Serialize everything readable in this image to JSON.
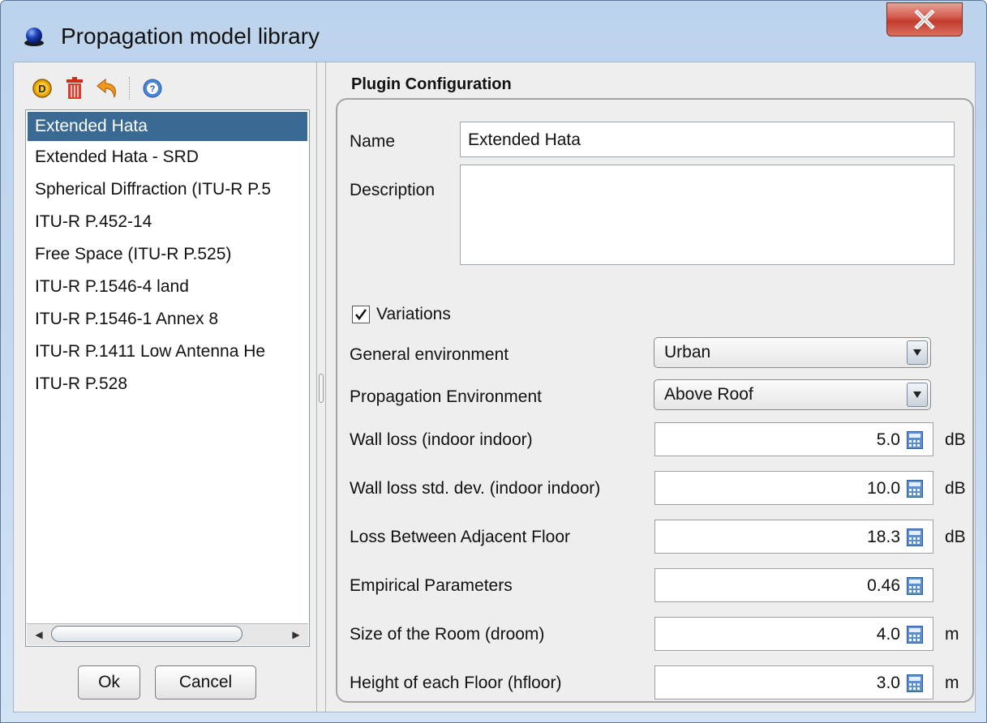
{
  "window": {
    "title": "Propagation model library"
  },
  "toolbar": {
    "icons": [
      "duplicate-icon",
      "delete-icon",
      "undo-icon",
      "help-icon"
    ]
  },
  "model_list": {
    "items": [
      "Extended Hata",
      "Extended Hata - SRD",
      "Spherical Diffraction (ITU-R P.5",
      "ITU-R P.452-14",
      "Free Space (ITU-R P.525)",
      "ITU-R P.1546-4 land",
      "ITU-R P.1546-1 Annex 8",
      "ITU-R P.1411 Low Antenna He",
      "ITU-R P.528"
    ],
    "selected": "Extended Hata"
  },
  "buttons": {
    "ok": "Ok",
    "cancel": "Cancel"
  },
  "config": {
    "section_title": "Plugin Configuration",
    "name_label": "Name",
    "name_value": "Extended Hata",
    "description_label": "Description",
    "description_value": "",
    "variations_label": "Variations",
    "variations_checked": true,
    "general_env_label": "General environment",
    "general_env_value": "Urban",
    "prop_env_label": "Propagation Environment",
    "prop_env_value": "Above Roof",
    "params": [
      {
        "label": "Wall loss (indoor indoor)",
        "value": "5.0",
        "unit": "dB"
      },
      {
        "label": "Wall loss std. dev. (indoor indoor)",
        "value": "10.0",
        "unit": "dB"
      },
      {
        "label": "Loss Between Adjacent Floor",
        "value": "18.3",
        "unit": "dB"
      },
      {
        "label": "Empirical Parameters",
        "value": "0.46",
        "unit": ""
      },
      {
        "label": "Size of the Room (droom)",
        "value": "4.0",
        "unit": "m"
      },
      {
        "label": "Height of each Floor (hfloor)",
        "value": "3.0",
        "unit": "m"
      }
    ]
  },
  "colors": {
    "selection": "#3a6a93",
    "close_button": "#c9483a"
  }
}
